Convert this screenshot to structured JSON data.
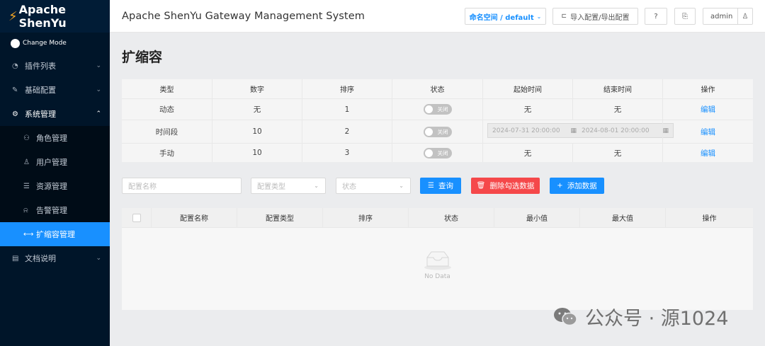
{
  "sidebar": {
    "logo": "Apache ShenYu",
    "mode": "Change Mode",
    "items": [
      {
        "label": "插件列表"
      },
      {
        "label": "基础配置"
      },
      {
        "label": "系统管理"
      },
      {
        "label": "文档说明"
      }
    ],
    "sub_items": [
      {
        "label": "角色管理"
      },
      {
        "label": "用户管理"
      },
      {
        "label": "资源管理"
      },
      {
        "label": "告警管理"
      },
      {
        "label": "扩缩容管理"
      }
    ]
  },
  "header": {
    "title": "Apache ShenYu Gateway Management System",
    "namespace": "命名空间 / default",
    "import_export": "导入配置/导出配置",
    "user": "admin"
  },
  "page": {
    "title": "扩缩容"
  },
  "strategy_table": {
    "columns": [
      "类型",
      "数字",
      "排序",
      "状态",
      "起始时间",
      "结束时间",
      "操作"
    ],
    "rows": [
      {
        "type": "动态",
        "number": "无",
        "order": "1",
        "status": "关闭",
        "start": "无",
        "end": "无",
        "action": "编辑"
      },
      {
        "type": "时间段",
        "number": "10",
        "order": "2",
        "status": "关闭",
        "start": "2024-07-31 20:00:00",
        "end": "2024-08-01 20:00:00",
        "action": "编辑"
      },
      {
        "type": "手动",
        "number": "10",
        "order": "3",
        "status": "关闭",
        "start": "无",
        "end": "无",
        "action": "编辑"
      }
    ]
  },
  "filters": {
    "name_placeholder": "配置名称",
    "type_placeholder": "配置类型",
    "status_placeholder": "状态",
    "query": "查询",
    "delete_selected": "删除勾选数据",
    "add": "添加数据"
  },
  "config_table": {
    "columns": [
      "配置名称",
      "配置类型",
      "排序",
      "状态",
      "最小值",
      "最大值",
      "操作"
    ],
    "empty_text": "No Data"
  },
  "watermark": {
    "text": "公众号 · 源1024"
  },
  "colors": {
    "sidebar": "#001529",
    "active": "#1890ff",
    "danger": "#f5484a"
  }
}
